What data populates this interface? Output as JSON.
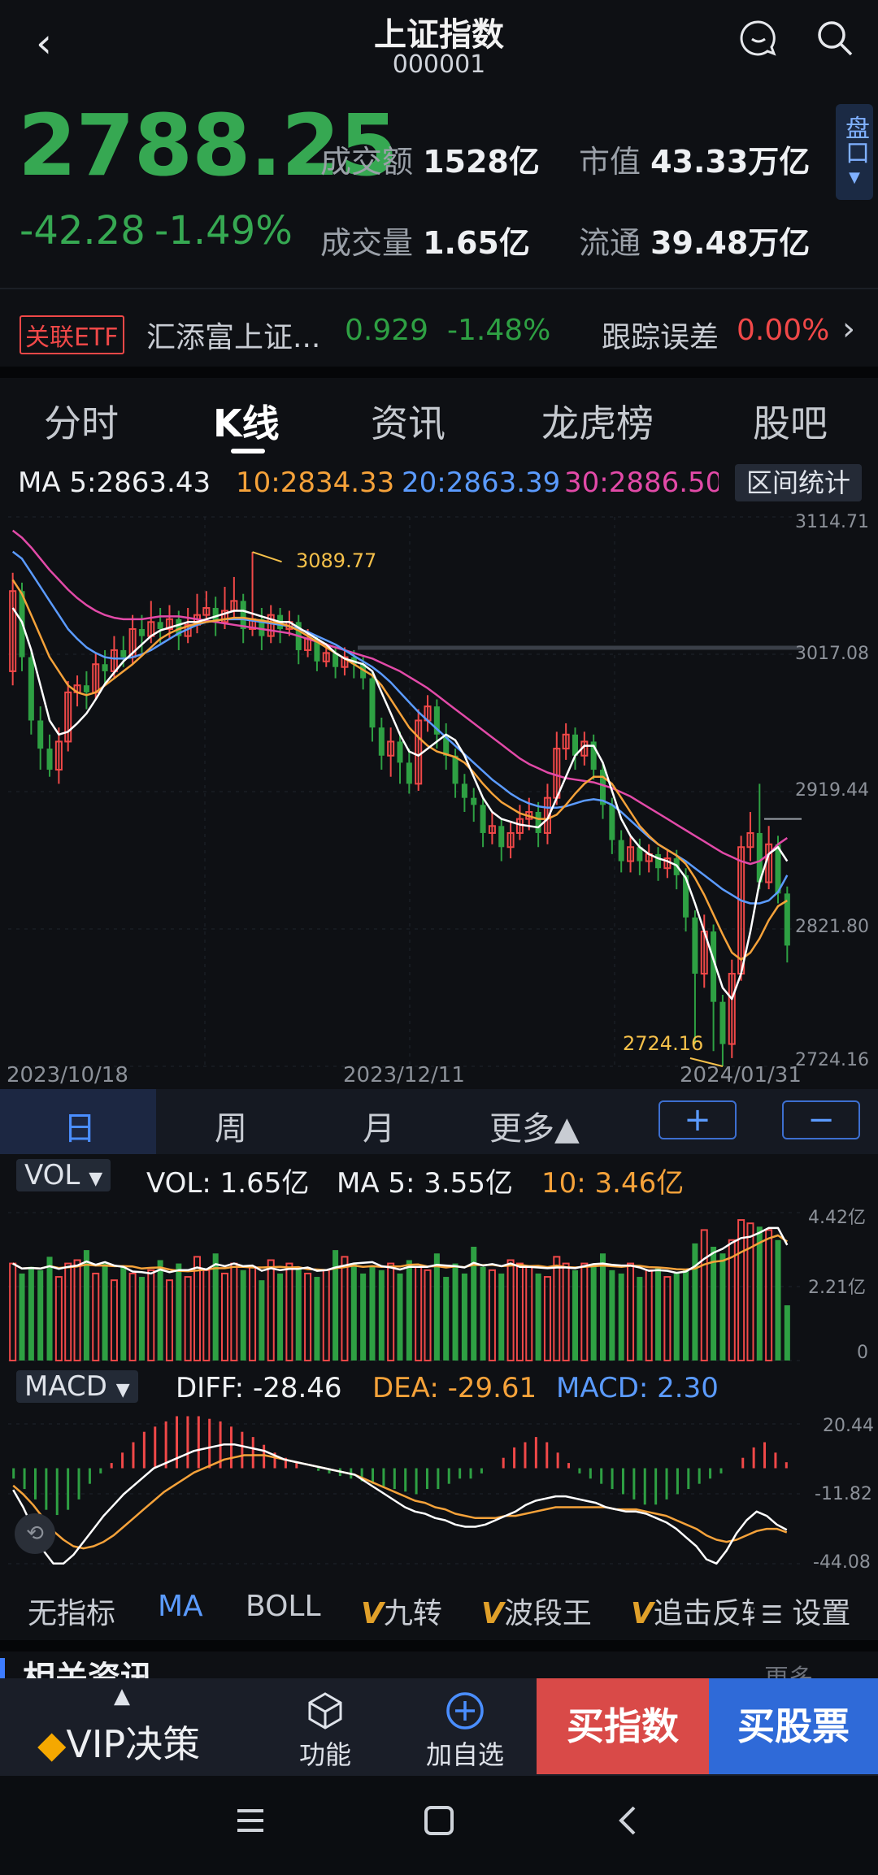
{
  "header": {
    "title": "上证指数",
    "code": "000001"
  },
  "quote": {
    "price": "2788.25",
    "change": "-42.28",
    "change_pct": "-1.49%",
    "turnover_label": "成交额",
    "turnover_value": "1528亿",
    "market_cap_label": "市值",
    "market_cap_value": "43.33万亿",
    "volume_label": "成交量",
    "volume_value": "1.65亿",
    "float_label": "流通",
    "float_value": "39.48万亿",
    "side_tab": "盘口"
  },
  "etf": {
    "badge": "关联ETF",
    "name": "汇添富上证...",
    "price": "0.929",
    "change_pct": "-1.48%",
    "err_label": "跟踪误差",
    "err_value": "0.00%"
  },
  "tabs": [
    "分时",
    "K线",
    "资讯",
    "龙虎榜",
    "股吧"
  ],
  "ma_row": {
    "ma5": "MA 5:2863.43",
    "ma10": "10:2834.33",
    "ma20": "20:2863.39",
    "ma30": "30:2886.50",
    "range_btn": "区间统计"
  },
  "kline": {
    "y_labels": [
      "3114.71",
      "3017.08",
      "2919.44",
      "2821.80",
      "2724.16"
    ],
    "dates": [
      "2023/10/18",
      "2023/12/11",
      "2024/01/31"
    ],
    "high_label": "3089.77",
    "low_label": "2724.16"
  },
  "periods": [
    "日",
    "周",
    "月",
    "更多▲"
  ],
  "zoom": {
    "plus": "+",
    "minus": "−"
  },
  "vol": {
    "selector": "VOL",
    "vol": "VOL: 1.65亿",
    "ma5": "MA 5: 3.55亿",
    "ma10": "10: 3.46亿",
    "y_labels": [
      "4.42亿",
      "2.21亿",
      "0"
    ]
  },
  "macd": {
    "selector": "MACD",
    "diff": "DIFF: -28.46",
    "dea": "DEA: -29.61",
    "macd": "MACD: 2.30",
    "y_labels": [
      "20.44",
      "-11.82",
      "-44.08"
    ]
  },
  "indicators": {
    "none": "无指标",
    "ma": "MA",
    "boll": "BOLL",
    "jiuzhuan": "九转",
    "boduan": "波段王",
    "zhuiji": "追击反转",
    "settings": "设置"
  },
  "bottom": {
    "vip": "VIP决策",
    "func": "功能",
    "add": "加自选",
    "buy_index": "买指数",
    "buy_stock": "买股票",
    "news_peek": "相关资讯",
    "more_peek": "更多"
  },
  "colors": {
    "up": "#f04848",
    "down": "#2ea043",
    "ma5": "#ffffff",
    "ma10": "#f5a23a",
    "ma20": "#5b9bff",
    "ma30": "#e24aa8"
  },
  "chart_data": {
    "type": "candlestick",
    "ylim": [
      2724.16,
      3114.71
    ],
    "dates": [
      "2023/10/18",
      "2023/12/11",
      "2024/01/31"
    ],
    "candles": [
      [
        3005,
        3062,
        3075,
        2995
      ],
      [
        3062,
        3015,
        3068,
        3005
      ],
      [
        3015,
        2970,
        3020,
        2960
      ],
      [
        2970,
        2950,
        2980,
        2935
      ],
      [
        2950,
        2935,
        2960,
        2930
      ],
      [
        2935,
        2955,
        2965,
        2925
      ],
      [
        2955,
        2990,
        2998,
        2948
      ],
      [
        2990,
        2995,
        3002,
        2980
      ],
      [
        2995,
        2990,
        3005,
        2978
      ],
      [
        2990,
        3010,
        3018,
        2985
      ],
      [
        3010,
        3005,
        3020,
        2995
      ],
      [
        3005,
        3020,
        3030,
        3000
      ],
      [
        3020,
        3015,
        3030,
        3008
      ],
      [
        3015,
        3035,
        3045,
        3010
      ],
      [
        3035,
        3030,
        3045,
        3018
      ],
      [
        3030,
        3040,
        3055,
        3025
      ],
      [
        3040,
        3035,
        3050,
        3025
      ],
      [
        3035,
        3042,
        3052,
        3028
      ],
      [
        3042,
        3030,
        3048,
        3020
      ],
      [
        3030,
        3038,
        3050,
        3025
      ],
      [
        3038,
        3045,
        3060,
        3032
      ],
      [
        3045,
        3050,
        3062,
        3040
      ],
      [
        3050,
        3040,
        3058,
        3030
      ],
      [
        3040,
        3048,
        3065,
        3035
      ],
      [
        3048,
        3055,
        3072,
        3042
      ],
      [
        3055,
        3035,
        3060,
        3025
      ],
      [
        3035,
        3042,
        3089.77,
        3030
      ],
      [
        3042,
        3030,
        3050,
        3020
      ],
      [
        3030,
        3045,
        3052,
        3025
      ],
      [
        3045,
        3035,
        3050,
        3025
      ],
      [
        3035,
        3040,
        3048,
        3030
      ],
      [
        3040,
        3020,
        3045,
        3010
      ],
      [
        3020,
        3028,
        3035,
        3015
      ],
      [
        3028,
        3012,
        3030,
        3005
      ],
      [
        3012,
        3018,
        3025,
        3008
      ],
      [
        3018,
        3008,
        3022,
        3000
      ],
      [
        3008,
        3015,
        3022,
        3002
      ],
      [
        3015,
        3010,
        3020,
        3000
      ],
      [
        3010,
        3000,
        3015,
        2992
      ],
      [
        3000,
        2965,
        3005,
        2955
      ],
      [
        2965,
        2945,
        2972,
        2935
      ],
      [
        2945,
        2955,
        2965,
        2930
      ],
      [
        2955,
        2940,
        2962,
        2925
      ],
      [
        2940,
        2925,
        2950,
        2918
      ],
      [
        2925,
        2970,
        2978,
        2920
      ],
      [
        2970,
        2980,
        2988,
        2962
      ],
      [
        2980,
        2960,
        2985,
        2950
      ],
      [
        2960,
        2945,
        2968,
        2935
      ],
      [
        2945,
        2925,
        2950,
        2915
      ],
      [
        2925,
        2915,
        2932,
        2905
      ],
      [
        2915,
        2910,
        2922,
        2898
      ],
      [
        2910,
        2890,
        2915,
        2880
      ],
      [
        2890,
        2895,
        2905,
        2882
      ],
      [
        2895,
        2880,
        2900,
        2870
      ],
      [
        2880,
        2890,
        2898,
        2872
      ],
      [
        2890,
        2900,
        2910,
        2885
      ],
      [
        2900,
        2905,
        2915,
        2892
      ],
      [
        2905,
        2890,
        2912,
        2880
      ],
      [
        2890,
        2915,
        2925,
        2882
      ],
      [
        2915,
        2950,
        2962,
        2910
      ],
      [
        2950,
        2960,
        2968,
        2942
      ],
      [
        2960,
        2945,
        2965,
        2935
      ],
      [
        2945,
        2955,
        2962,
        2938
      ],
      [
        2955,
        2935,
        2960,
        2928
      ],
      [
        2935,
        2910,
        2940,
        2900
      ],
      [
        2910,
        2885,
        2915,
        2875
      ],
      [
        2885,
        2870,
        2892,
        2862
      ],
      [
        2870,
        2880,
        2888,
        2862
      ],
      [
        2880,
        2870,
        2886,
        2860
      ],
      [
        2870,
        2875,
        2882,
        2862
      ],
      [
        2875,
        2865,
        2880,
        2856
      ],
      [
        2865,
        2872,
        2878,
        2858
      ],
      [
        2872,
        2860,
        2878,
        2850
      ],
      [
        2860,
        2830,
        2865,
        2820
      ],
      [
        2830,
        2790,
        2835,
        2740
      ],
      [
        2790,
        2820,
        2832,
        2780
      ],
      [
        2820,
        2770,
        2825,
        2735
      ],
      [
        2770,
        2740,
        2775,
        2724.16
      ],
      [
        2740,
        2790,
        2800,
        2730
      ],
      [
        2790,
        2880,
        2888,
        2785
      ],
      [
        2880,
        2890,
        2905,
        2870
      ],
      [
        2890,
        2855,
        2925,
        2850
      ],
      [
        2855,
        2882,
        2895,
        2850
      ],
      [
        2882,
        2847,
        2888,
        2840
      ],
      [
        2847,
        2810,
        2852,
        2798
      ]
    ],
    "ma5": [
      3050,
      3040,
      3020,
      2995,
      2970,
      2960,
      2962,
      2968,
      2975,
      2985,
      2996,
      3004,
      3012,
      3018,
      3024,
      3030,
      3034,
      3036,
      3038,
      3040,
      3040,
      3042,
      3044,
      3046,
      3048,
      3048,
      3046,
      3044,
      3042,
      3040,
      3040,
      3036,
      3032,
      3028,
      3024,
      3018,
      3014,
      3012,
      3010,
      3005,
      2990,
      2975,
      2960,
      2948,
      2945,
      2950,
      2955,
      2960,
      2956,
      2945,
      2930,
      2915,
      2905,
      2900,
      2898,
      2896,
      2895,
      2894,
      2900,
      2915,
      2930,
      2945,
      2952,
      2952,
      2940,
      2920,
      2900,
      2888,
      2880,
      2875,
      2872,
      2870,
      2867,
      2858,
      2840,
      2820,
      2800,
      2780,
      2772,
      2790,
      2820,
      2855,
      2875,
      2880,
      2870
    ],
    "ma10": [
      3070,
      3060,
      3045,
      3030,
      3015,
      3005,
      2995,
      2990,
      2988,
      2990,
      2995,
      3000,
      3005,
      3010,
      3016,
      3022,
      3028,
      3032,
      3035,
      3037,
      3039,
      3040,
      3041,
      3042,
      3043,
      3043,
      3042,
      3041,
      3040,
      3039,
      3037,
      3034,
      3030,
      3026,
      3022,
      3018,
      3014,
      3010,
      3006,
      3002,
      2995,
      2985,
      2975,
      2965,
      2958,
      2952,
      2948,
      2946,
      2944,
      2940,
      2933,
      2925,
      2918,
      2912,
      2908,
      2904,
      2902,
      2900,
      2900,
      2903,
      2910,
      2918,
      2925,
      2930,
      2930,
      2925,
      2915,
      2905,
      2895,
      2888,
      2882,
      2878,
      2874,
      2868,
      2858,
      2846,
      2832,
      2818,
      2805,
      2800,
      2805,
      2815,
      2828,
      2838,
      2842
    ],
    "ma20": [
      3090,
      3085,
      3075,
      3065,
      3055,
      3045,
      3035,
      3028,
      3022,
      3018,
      3015,
      3014,
      3014,
      3015,
      3017,
      3020,
      3024,
      3028,
      3032,
      3035,
      3038,
      3040,
      3041,
      3042,
      3042,
      3042,
      3041,
      3040,
      3039,
      3038,
      3037,
      3035,
      3033,
      3030,
      3027,
      3024,
      3020,
      3016,
      3012,
      3008,
      3003,
      2997,
      2990,
      2983,
      2976,
      2970,
      2964,
      2958,
      2952,
      2946,
      2940,
      2934,
      2928,
      2923,
      2918,
      2914,
      2911,
      2909,
      2908,
      2908,
      2909,
      2911,
      2913,
      2914,
      2913,
      2910,
      2905,
      2899,
      2893,
      2887,
      2882,
      2878,
      2874,
      2870,
      2865,
      2860,
      2855,
      2850,
      2846,
      2842,
      2840,
      2840,
      2842,
      2848,
      2860
    ],
    "ma30": [
      3105,
      3100,
      3093,
      3085,
      3077,
      3070,
      3063,
      3057,
      3052,
      3048,
      3045,
      3043,
      3042,
      3042,
      3042,
      3043,
      3044,
      3044,
      3044,
      3043,
      3042,
      3041,
      3040,
      3039,
      3038,
      3037,
      3036,
      3035,
      3034,
      3033,
      3032,
      3030,
      3028,
      3026,
      3024,
      3022,
      3020,
      3018,
      3016,
      3014,
      3011,
      3008,
      3005,
      3001,
      2997,
      2993,
      2988,
      2983,
      2978,
      2973,
      2968,
      2963,
      2958,
      2953,
      2948,
      2943,
      2939,
      2936,
      2933,
      2931,
      2929,
      2928,
      2927,
      2926,
      2924,
      2922,
      2919,
      2916,
      2912,
      2908,
      2904,
      2900,
      2896,
      2892,
      2888,
      2884,
      2880,
      2876,
      2873,
      2870,
      2868,
      2870,
      2875,
      2882,
      2886.5
    ],
    "volume": [
      2.9,
      2.6,
      2.8,
      2.7,
      3.1,
      2.5,
      2.9,
      3.0,
      3.3,
      2.6,
      2.9,
      2.4,
      2.8,
      2.6,
      2.5,
      2.7,
      3.0,
      2.4,
      2.9,
      2.5,
      3.1,
      2.7,
      3.2,
      2.6,
      2.9,
      2.7,
      2.8,
      2.4,
      3.0,
      2.6,
      2.9,
      2.8,
      2.6,
      2.5,
      2.7,
      3.3,
      3.1,
      2.9,
      2.6,
      2.8,
      2.7,
      2.9,
      2.6,
      3.0,
      2.8,
      2.7,
      3.2,
      2.5,
      2.9,
      2.6,
      3.4,
      2.8,
      2.7,
      2.6,
      3.0,
      2.9,
      2.8,
      2.6,
      2.5,
      3.1,
      2.9,
      2.7,
      2.9,
      2.8,
      3.2,
      2.7,
      2.6,
      2.9,
      2.5,
      2.7,
      2.8,
      2.5,
      2.6,
      2.7,
      3.5,
      3.9,
      3.4,
      3.2,
      3.6,
      4.2,
      4.1,
      4.0,
      3.9,
      3.6,
      1.65
    ],
    "diff": [
      -10,
      -18,
      -28,
      -38,
      -44,
      -44,
      -40,
      -34,
      -28,
      -22,
      -17,
      -12,
      -8,
      -4,
      0,
      2,
      4,
      6,
      8,
      9,
      10,
      11,
      11,
      10,
      9,
      8,
      6,
      4,
      3,
      2,
      1,
      0,
      -1,
      -2,
      -3,
      -6,
      -9,
      -12,
      -15,
      -18,
      -20,
      -21,
      -23,
      -24,
      -26,
      -27,
      -27,
      -26,
      -24,
      -22,
      -20,
      -17,
      -15,
      -14,
      -13,
      -13,
      -14,
      -15,
      -16,
      -18,
      -19,
      -20,
      -20,
      -21,
      -23,
      -25,
      -28,
      -32,
      -36,
      -42,
      -44,
      -38,
      -30,
      -24,
      -20,
      -22,
      -26,
      -28.46
    ],
    "dea": [
      -8,
      -12,
      -17,
      -23,
      -29,
      -33,
      -36,
      -37,
      -36,
      -34,
      -31,
      -27,
      -23,
      -19,
      -15,
      -11,
      -8,
      -5,
      -2,
      0,
      2,
      4,
      5,
      6,
      6,
      6,
      5,
      4,
      3,
      2,
      1,
      0,
      -1,
      -2,
      -3,
      -5,
      -7,
      -9,
      -11,
      -13,
      -15,
      -16,
      -18,
      -19,
      -21,
      -22,
      -23,
      -23,
      -23,
      -22,
      -22,
      -21,
      -20,
      -19,
      -18,
      -18,
      -18,
      -18,
      -18,
      -18,
      -19,
      -19,
      -19,
      -20,
      -21,
      -22,
      -24,
      -26,
      -28,
      -31,
      -33,
      -34,
      -33,
      -31,
      -29,
      -28,
      -28,
      -29.61
    ],
    "macd": [
      -4,
      -8,
      -12,
      -16,
      -18,
      -16,
      -12,
      -6,
      -2,
      2,
      6,
      10,
      14,
      16,
      18,
      20,
      20,
      20,
      19,
      18,
      16,
      14,
      12,
      9,
      6,
      4,
      2,
      0,
      -1,
      -2,
      -3,
      -4,
      -5,
      -6,
      -7,
      -8,
      -9,
      -10,
      -8,
      -8,
      -6,
      -4,
      -4,
      -2,
      0,
      4,
      8,
      10,
      12,
      10,
      6,
      2,
      -2,
      -4,
      -6,
      -8,
      -10,
      -12,
      -14,
      -14,
      -12,
      -10,
      -8,
      -6,
      -4,
      -2,
      0,
      4,
      8,
      10,
      6,
      2.3
    ]
  }
}
